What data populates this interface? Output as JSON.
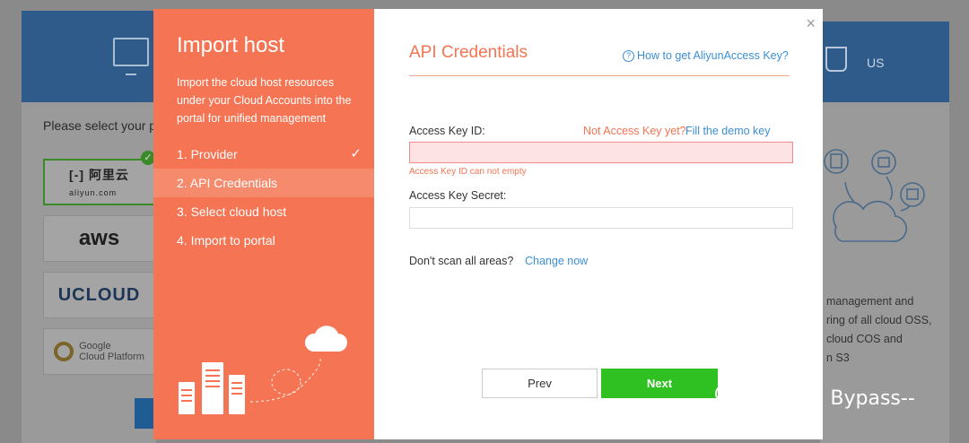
{
  "background": {
    "select_prompt": "Please select your p",
    "providers": [
      {
        "name": "aliyun",
        "label_cn": "阿里云",
        "label_en": "aliyun.com"
      },
      {
        "name": "aws",
        "label": "aws"
      },
      {
        "name": "ucloud",
        "label": "UCLOUD"
      },
      {
        "name": "google",
        "label_line1": "Google",
        "label_line2": "Cloud Platform"
      }
    ],
    "right_card_label": "US",
    "right_paragraph": [
      "management and",
      "ring of all cloud OSS,",
      "cloud COS and",
      "n S3"
    ]
  },
  "modal": {
    "left": {
      "title": "Import host",
      "description": "Import the cloud host resources under your Cloud Accounts into the portal for unified management",
      "steps": [
        {
          "label": "1. Provider",
          "done": true
        },
        {
          "label": "2. API Credentials",
          "active": true
        },
        {
          "label": "3. Select cloud host"
        },
        {
          "label": "4. Import to portal"
        }
      ],
      "check_glyph": "✓"
    },
    "right": {
      "close_glyph": "×",
      "title": "API Credentials",
      "help_icon": "?",
      "help_link": "How to get AliyunAccess Key?",
      "access_key_id_label": "Access Key ID:",
      "not_access_key_text": "Not Access Key yet?",
      "fill_demo_link": "Fill the demo key",
      "access_key_id_value": "",
      "access_key_id_error": "Access Key ID can not empty",
      "access_key_secret_label": "Access Key Secret:",
      "access_key_secret_value": "",
      "scan_text": "Don't scan all areas?",
      "change_link": "Change now",
      "prev_label": "Prev",
      "next_label": "Next"
    }
  },
  "watermark": {
    "text": "微信号: Bypass--"
  },
  "colors": {
    "accent": "#f47453",
    "link": "#3b8ed5",
    "primary_button": "#2fc022",
    "error_bg": "#fde3e3"
  }
}
